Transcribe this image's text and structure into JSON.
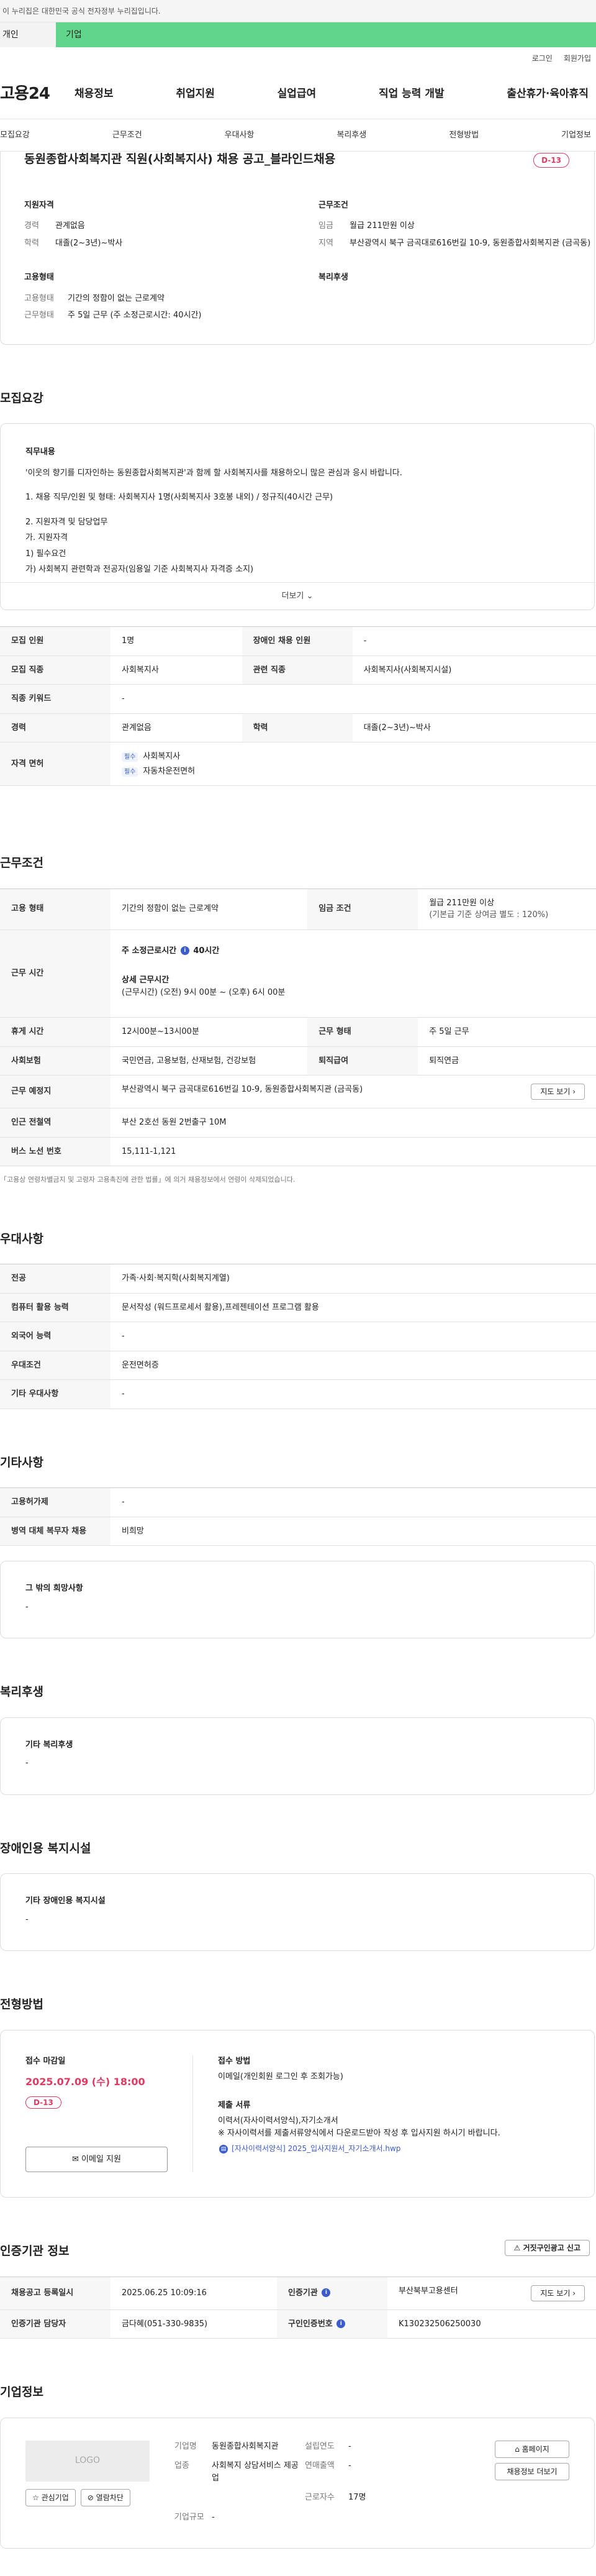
{
  "gov_notice": "이 누리집은 대한민국 공식 전자정부 누리집입니다.",
  "audience_tabs": [
    "개인",
    "기업"
  ],
  "util_links": [
    "로그인",
    "회원가입"
  ],
  "logo": "고용24",
  "gnb": [
    "채용정보",
    "취업지원",
    "실업급여",
    "직업 능력 개발",
    "출산휴가·육아휴직"
  ],
  "anchors": [
    "모집요강",
    "근무조건",
    "우대사항",
    "복리후생",
    "전형방법",
    "기업정보"
  ],
  "title": "동원종합사회복지관 직원(사회복지사) 채용 공고_블라인드채용",
  "dday": "D-13",
  "summary": {
    "qual": {
      "heading": "지원자격",
      "rows": [
        {
          "k": "경력",
          "v": "관계없음"
        },
        {
          "k": "학력",
          "v": "대졸(2~3년)~박사"
        }
      ]
    },
    "cond": {
      "heading": "근무조건",
      "rows": [
        {
          "k": "임금",
          "v": "월급 211만원 이상"
        },
        {
          "k": "지역",
          "v": "부산광역시 북구 금곡대로616번길 10-9, 동원종합사회복지관 (금곡동)"
        }
      ]
    },
    "emp": {
      "heading": "고용형태",
      "rows": [
        {
          "k": "고용형태",
          "v": "기간의 정함이 없는 근로계약"
        },
        {
          "k": "근무형태",
          "v": "주 5일 근무 (주 소정근로시간: 40시간)"
        }
      ]
    },
    "welfare": {
      "heading": "복리후생"
    }
  },
  "sections": {
    "recruit": "모집요강",
    "work": "근무조건",
    "pref": "우대사항",
    "etc": "기타사항",
    "welfare": "복리후생",
    "disabled": "장애인용 복지시설",
    "process": "전형방법",
    "auth": "인증기관 정보",
    "corp": "기업정보"
  },
  "desc": {
    "h": "직무내용",
    "lines": [
      "'이웃의 향기를 디자인하는 동원종합사회복지관'과 함께 할 사회복지사를 채용하오니 많은 관심과 응시 바랍니다.",
      "1. 채용 직무/인원 및 형태: 사회복지사 1명(사회복지사 3호봉 내외) / 정규직(40시간 근무)",
      "2. 지원자격 및 담당업무",
      "가. 지원자격",
      "1) 필수요건",
      "가) 사회복지 관련학과 전공자(임용일 기준 사회복지사 자격증 소지)"
    ],
    "more": "더보기"
  },
  "recruit_table": {
    "headcount_k": "모집 인원",
    "headcount_v": "1명",
    "disabled_k": "장애인 채용 인원",
    "disabled_v": "-",
    "job_k": "모집 직종",
    "job_v": "사회복지사",
    "related_k": "관련 직종",
    "related_v": "사회복지사(사회복지시설)",
    "kw_k": "직종 키워드",
    "kw_v": "-",
    "career_k": "경력",
    "career_v": "관계없음",
    "edu_k": "학력",
    "edu_v": "대졸(2~3년)~박사",
    "lic_k": "자격 면허",
    "lic_tag": "필수",
    "lic": [
      "사회복지사",
      "자동차운전면허"
    ]
  },
  "work_table": {
    "type_k": "고용 형태",
    "type_v": "기간의 정함이 없는 근로계약",
    "wage_k": "임금 조건",
    "wage_v1": "월급 211만원 이상",
    "wage_v2": "(기본급 기준 상여금 별도 : 120%)",
    "hours_k": "근무 시간",
    "hours_main": "주 소정근로시간",
    "hours_icon": "i",
    "hours_val": "40시간",
    "hours_detail_h": "상세 근무시간",
    "hours_detail": "(근무시간) (오전) 9시 00분 ~ (오후) 6시 00분",
    "rest_k": "휴게 시간",
    "rest_v": "12시00분~13시00분",
    "form_k": "근무 형태",
    "form_v": "주 5일 근무",
    "ins_k": "사회보험",
    "ins_v": "국민연금, 고용보험, 산재보험, 건강보험",
    "ret_k": "퇴직급여",
    "ret_v": "퇴직연금",
    "place_k": "근무 예정지",
    "place_v": "부산광역시 북구 금곡대로616번길 10-9, 동원종합사회복지관 (금곡동)",
    "map_btn": "지도 보기",
    "subway_k": "인근 전철역",
    "subway_v": "부산 2호선 동원 2번출구 10M",
    "bus_k": "버스 노선 번호",
    "bus_v": "15,111-1,121",
    "note": "「고용상 연령차별금지 및 고령자 고용촉진에 관한 법률」에 의거 채용정보에서 연령이 삭제되었습니다."
  },
  "pref_table": {
    "major_k": "전공",
    "major_v": "가족·사회·복지학(사회복지계열)",
    "pc_k": "컴퓨터 활용 능력",
    "pc_v": "문서작성 (워드프로세서 활용),프레젠테이션 프로그램 활용",
    "lang_k": "외국어 능력",
    "lang_v": "-",
    "pref_k": "우대조건",
    "pref_v": "운전면허증",
    "etc_k": "기타 우대사항",
    "etc_v": "-"
  },
  "etc_table": {
    "ins_k": "고용허가제",
    "ins_v": "-",
    "mil_k": "병역 대체 복무자 채용",
    "mil_v": "비희망"
  },
  "etc_card": {
    "h": "그 밖의 희망사항",
    "v": "-"
  },
  "welfare_card": {
    "h": "기타 복리후생",
    "v": "-"
  },
  "disabled_card": {
    "h": "기타 장애인용 복지시설",
    "v": "-"
  },
  "process": {
    "deadline_k": "접수 마감일",
    "deadline_v": "2025.07.09 (수) 18:00",
    "dday": "D-13",
    "email_btn": "이메일 지원",
    "method_h": "접수 방법",
    "method_v": "이메일(개인회원 로그인 후 조회가능)",
    "docs_h": "제출 서류",
    "docs": [
      "이력서(자사이력서양식),자기소개서",
      "※ 자사이력서를 제출서류양식에서 다운로드받아 작성 후 입사지원 하시기 바랍니다."
    ],
    "file": "[자사이력서양식] 2025_입사지원서_자기소개서.hwp"
  },
  "auth": {
    "report_btn": "거짓구인광고 신고",
    "reg_k": "채용공고 등록일시",
    "reg_v": "2025.06.25 10:09:16",
    "org_k": "인증기관",
    "org_v": "부산북부고용센터",
    "map_btn": "지도 보기",
    "mgr_k": "인증기관 담당자",
    "mgr_v": "금다혜(051-330-9835)",
    "id_k": "구인인증번호",
    "id_v": "K130232506250030"
  },
  "corp": {
    "logo": "LOGO",
    "fav": "관심기업",
    "block": "열람차단",
    "name_k": "기업명",
    "name_v": "동원종합사회복지관",
    "year_k": "설립연도",
    "year_v": "-",
    "ind_k": "업종",
    "ind_v": "사회복지 상담서비스 제공업",
    "sales_k": "연매출액",
    "sales_v": "-",
    "emp_k": "근로자수",
    "emp_v": "17명",
    "size_k": "기업규모",
    "size_v": "-",
    "home_btn": "홈페이지",
    "jobs_btn": "채용정보 더보기"
  }
}
